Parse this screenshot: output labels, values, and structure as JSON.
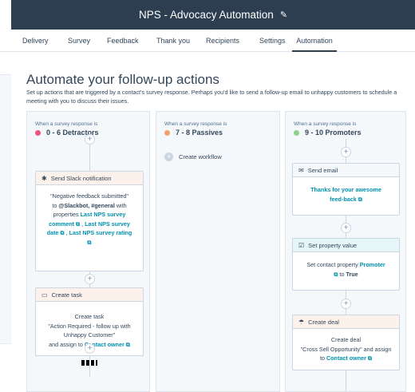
{
  "header": {
    "title": "NPS - Advocacy Automation"
  },
  "tabs": [
    {
      "label": "Delivery"
    },
    {
      "label": "Survey"
    },
    {
      "label": "Feedback"
    },
    {
      "label": "Thank you"
    },
    {
      "label": "Recipients"
    },
    {
      "label": "Settings"
    },
    {
      "label": "Automation",
      "active": true
    }
  ],
  "main": {
    "heading": "Automate your follow-up actions",
    "description": "Set up actions that are triggered by a contact's survey response. Perhaps you'd like to send a follow-up email to unhappy customers to schedule a meeting with you to discuss their issues."
  },
  "columns": [
    {
      "caption": "When a survey response is",
      "title": "0 - 6 Detractors",
      "dot_color": "#f2547d",
      "cards": [
        {
          "header": "Send Slack notification",
          "icon": "slack-icon",
          "body": {
            "text1": "\"Negative feedback submitted\"",
            "text2": "to",
            "bold1": "@Slackbot, #general",
            "text3": "with properties",
            "link1": "Last NPS survey comment",
            "link2": "Last NPS survey date",
            "link3": "Last NPS survey rating"
          }
        },
        {
          "header": "Create task",
          "icon": "task-icon",
          "body": {
            "text1": "Create task",
            "text2": "\"Action Required - follow up with Unhappy Customer\"",
            "text3": "and assign to",
            "link1": "Contact owner"
          }
        }
      ]
    },
    {
      "caption": "When a survey response is",
      "title": "7 - 8 Passives",
      "dot_color": "#f5a26a",
      "create_label": "Create workflow"
    },
    {
      "caption": "When a survey response is",
      "title": "9 - 10 Promoters",
      "dot_color": "#8fd18a",
      "cards": [
        {
          "header": "Send email",
          "icon": "email-icon",
          "body": {
            "link1": "Thanks for your awesome feed-back"
          }
        },
        {
          "header": "Set property value",
          "icon": "edit-icon",
          "body": {
            "text1": "Set contact property",
            "link1": "Promoter",
            "text2": "to",
            "bold1": "True"
          }
        },
        {
          "header": "Create deal",
          "icon": "deal-icon",
          "body": {
            "text1": "Create deal",
            "text2": "\"Cross Sell Opportunity\"",
            "text3": "and assign to",
            "link1": "Contact owner"
          }
        }
      ]
    }
  ]
}
